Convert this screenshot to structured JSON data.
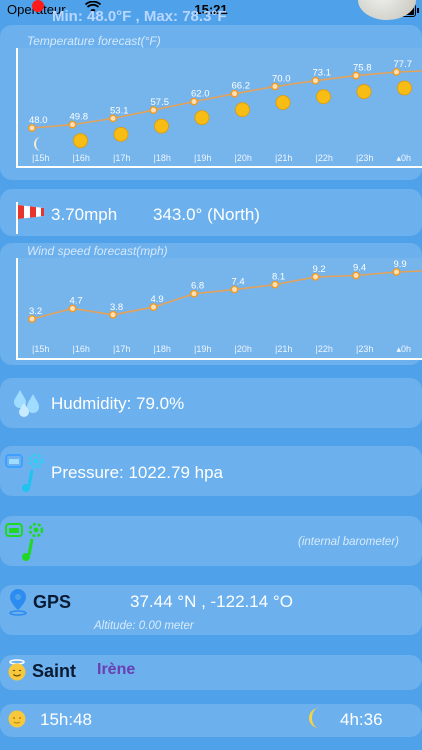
{
  "status": {
    "carrier": "Operateur",
    "time": "15:21"
  },
  "header": {
    "minmax": "Min: 48.0°F , Max: 78.3°F"
  },
  "temp_chart": {
    "title": "Temperature forecast(°F)",
    "hours": [
      "15h",
      "16h",
      "17h",
      "18h",
      "19h",
      "20h",
      "21h",
      "22h",
      "23h",
      "0h"
    ],
    "values": [
      48.0,
      49.8,
      53.1,
      57.5,
      62.0,
      66.2,
      70.0,
      73.1,
      75.8,
      77.7
    ],
    "labels": [
      "48.0",
      "49.8",
      "53.1",
      "57.5",
      "62.0",
      "66.2",
      "70.0",
      "73.1",
      "75.8",
      "77.7"
    ],
    "icons": [
      "moon-icon",
      "sun-icon",
      "sun-icon",
      "sun-icon",
      "sun-icon",
      "sun-icon",
      "sun-icon",
      "sun-icon",
      "sun-icon",
      "sun-icon"
    ]
  },
  "wind": {
    "speed": "3.70mph",
    "direction": "343.0° (North)"
  },
  "wind_chart": {
    "title": "Wind speed forecast(mph)",
    "hours": [
      "15h",
      "16h",
      "17h",
      "18h",
      "19h",
      "20h",
      "21h",
      "22h",
      "23h",
      "0h"
    ],
    "values": [
      3.2,
      4.7,
      3.8,
      4.9,
      6.8,
      7.4,
      8.1,
      9.2,
      9.4,
      9.9
    ],
    "labels": [
      "3.2",
      "4.7",
      "3.8",
      "4.9",
      "6.8",
      "7.4",
      "8.1",
      "9.2",
      "9.4",
      "9.9"
    ]
  },
  "humidity": {
    "text": "Hudmidity: 79.0%"
  },
  "pressure": {
    "text": "Pressure: 1022.79 hpa"
  },
  "barometer": {
    "note": "(internal barometer)"
  },
  "gps": {
    "label": "GPS",
    "coords": "37.44 °N , -122.14 °O",
    "altitude": "Altitude: 0.00 meter"
  },
  "saint": {
    "label": "Saint",
    "name": "Irène"
  },
  "sun": {
    "sunrise": "15h:48",
    "moon": "4h:36"
  },
  "colors": {
    "background": "#4fa2ea",
    "line": "#e3a25a",
    "point": "#f39a1f",
    "chart_bg": "#76b4ec"
  }
}
